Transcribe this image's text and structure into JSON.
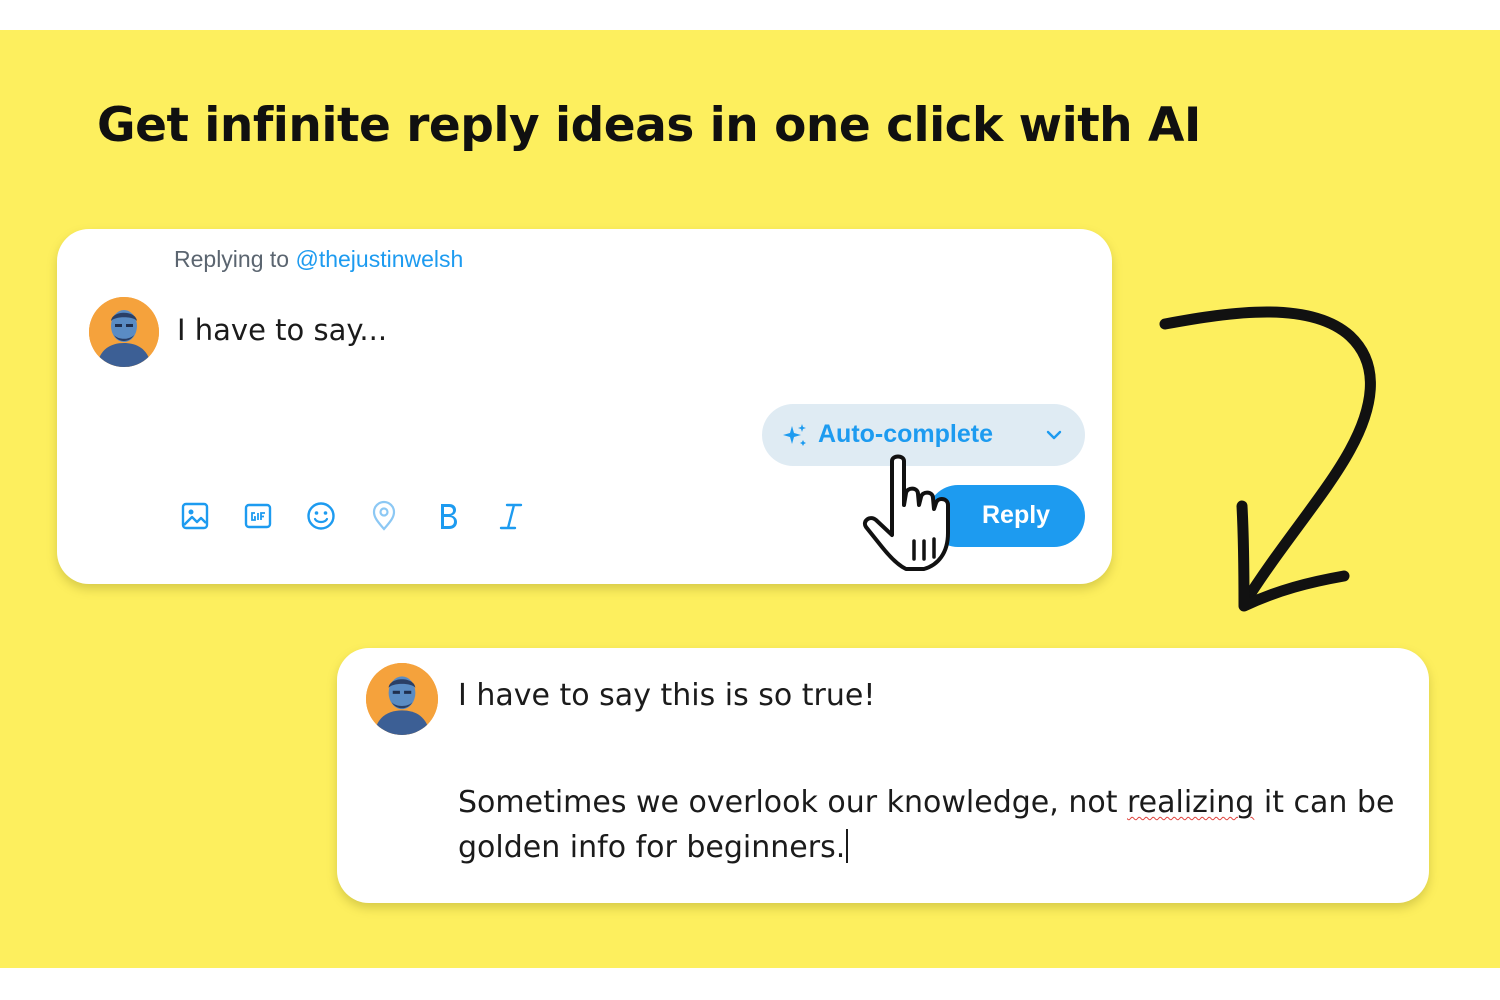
{
  "headline": "Get infinite reply ideas in one click with AI",
  "compose": {
    "replying_prefix": "Replying to",
    "replying_handle": "@thejustinwelsh",
    "draft_text": "I have to say...",
    "autocomplete_label": "Auto-complete",
    "reply_label": "Reply",
    "toolbar_icons": [
      "image-icon",
      "gif-icon",
      "emoji-icon",
      "location-icon",
      "bold-icon",
      "italic-icon"
    ]
  },
  "result": {
    "line1": "I have to say this is so true!",
    "para_before": "Sometimes we overlook our knowledge, not ",
    "para_misspelled": "realizing",
    "para_after": " it can be golden info for beginners."
  },
  "colors": {
    "background": "#fdef5e",
    "accent": "#1d9bf0",
    "autocomplete_bg": "#dfebf3",
    "avatar_bg": "#f5a23c"
  }
}
